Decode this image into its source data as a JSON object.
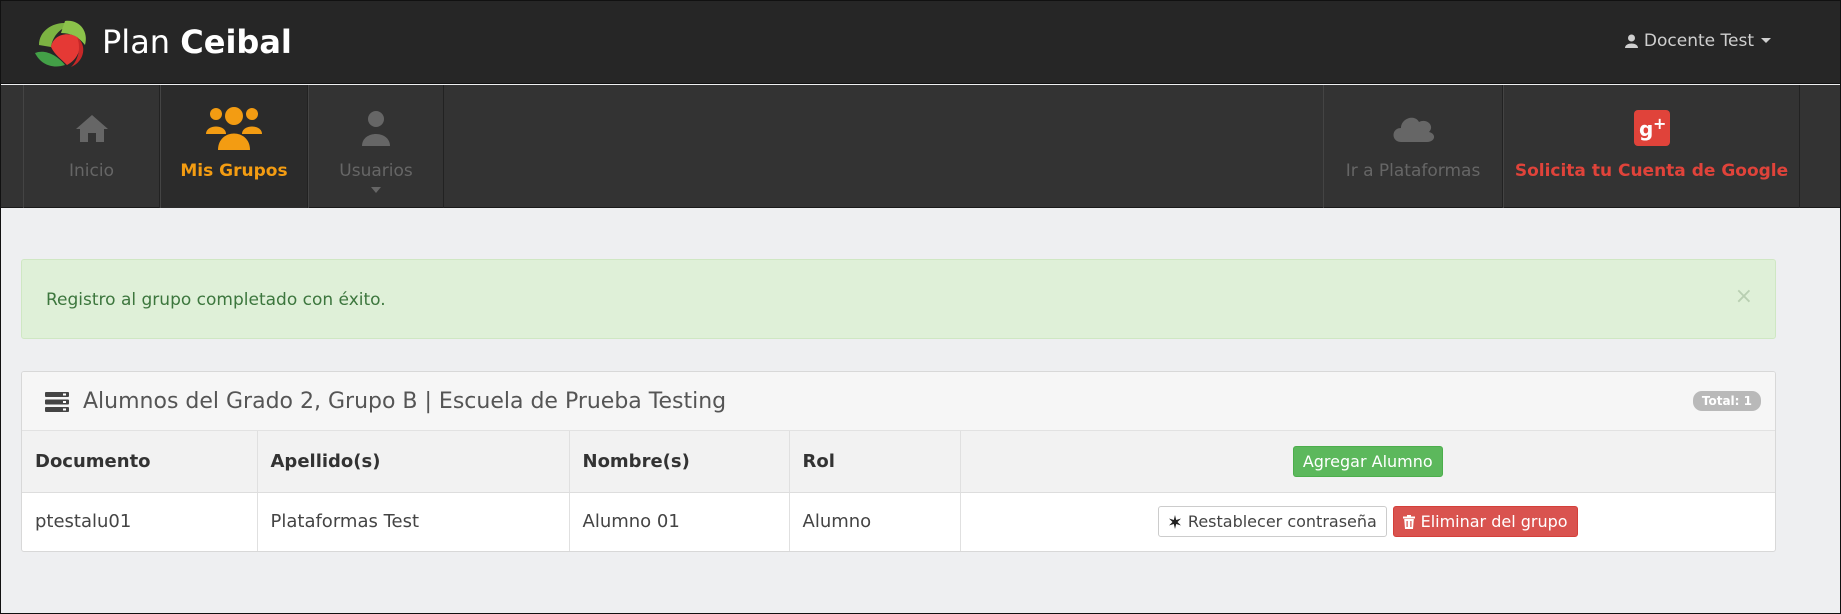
{
  "brand": {
    "name_part1": "Plan",
    "name_part2": "Ceibal"
  },
  "user": {
    "name": "Docente Test"
  },
  "nav": {
    "inicio": "Inicio",
    "mis_grupos": "Mis Grupos",
    "usuarios": "Usuarios",
    "plataformas": "Ir a Plataformas",
    "google": "Solicita tu Cuenta de Google"
  },
  "alert": {
    "message": "Registro al grupo completado con éxito.",
    "close": "×"
  },
  "panel": {
    "title": "Alumnos del Grado 2, Grupo B | Escuela de Prueba Testing",
    "total": "Total: 1"
  },
  "table": {
    "headers": [
      "Documento",
      "Apellido(s)",
      "Nombre(s)",
      "Rol"
    ],
    "add_button": "Agregar Alumno",
    "rows": [
      {
        "documento": "ptestalu01",
        "apellidos": "Plataformas Test",
        "nombres": "Alumno 01",
        "rol": "Alumno",
        "reset_label": "Restablecer contraseña",
        "remove_label": "Eliminar del grupo"
      }
    ]
  },
  "colors": {
    "accent_orange": "#f39c12",
    "google_red": "#e0433a",
    "success_green": "#5cb85c",
    "danger_red": "#d9534f"
  }
}
